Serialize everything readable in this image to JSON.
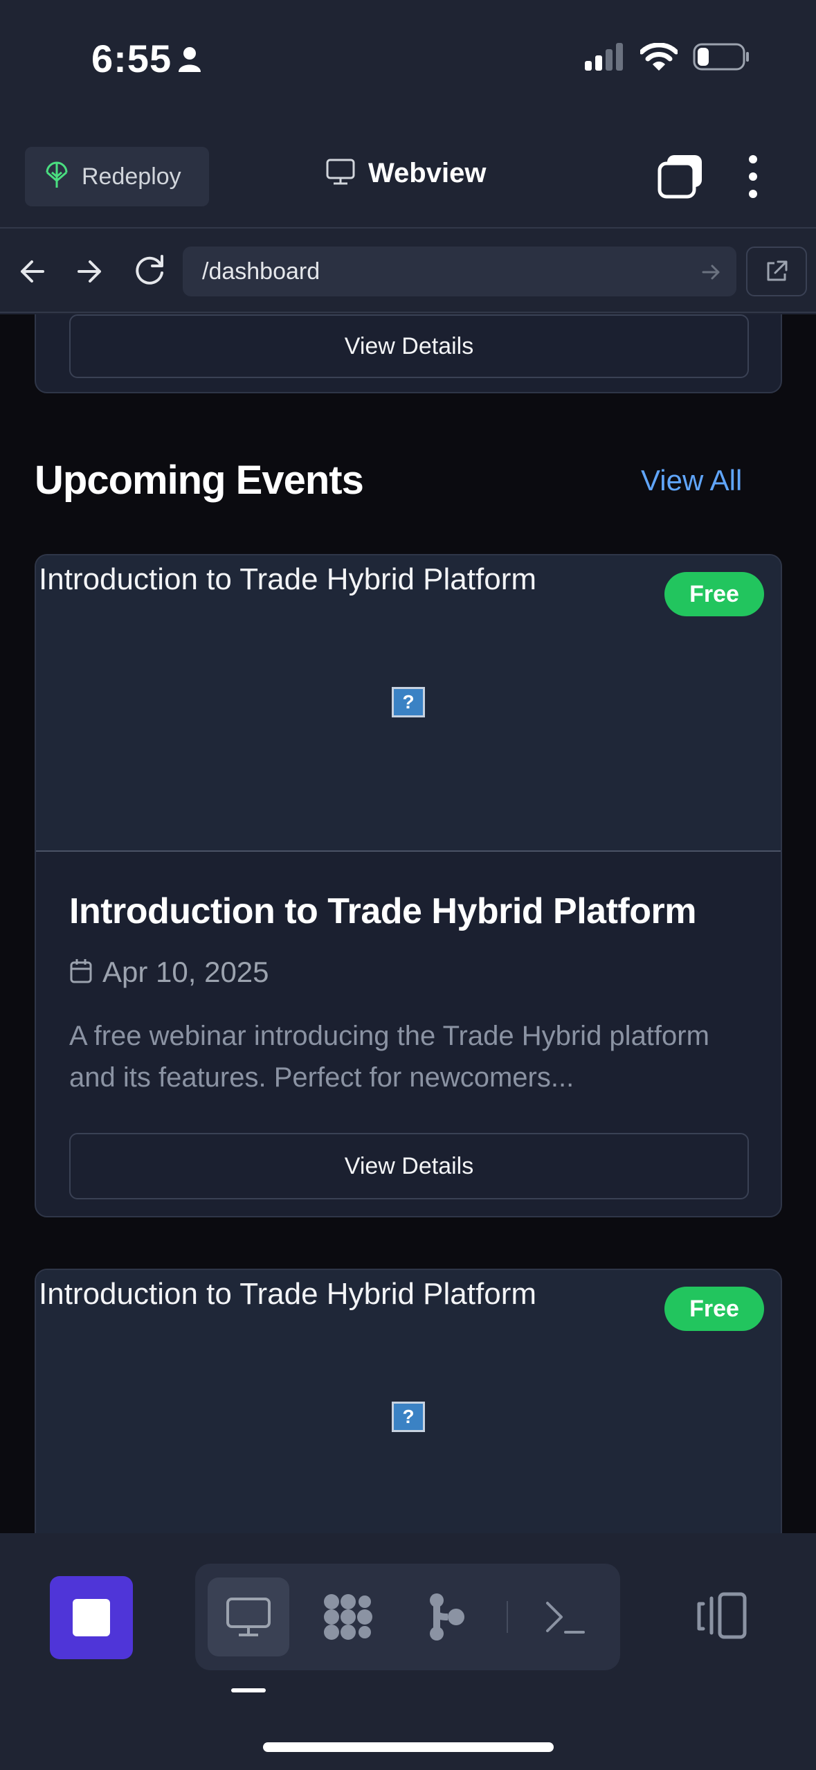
{
  "status_bar": {
    "time": "6:55"
  },
  "header": {
    "redeploy_label": "Redeploy",
    "title": "Webview"
  },
  "browser": {
    "url": "/dashboard"
  },
  "content": {
    "previous_card_button": "View Details",
    "section_title": "Upcoming Events",
    "view_all": "View All",
    "events": [
      {
        "image_alt": "Introduction to Trade Hybrid Platform",
        "badge": "Free",
        "title": "Introduction to Trade Hybrid Platform",
        "date": "Apr 10, 2025",
        "description": "A free webinar introducing the Trade Hybrid platform and its features. Perfect for newcomers...",
        "button": "View Details"
      },
      {
        "image_alt": "Introduction to Trade Hybrid Platform",
        "badge": "Free"
      }
    ]
  },
  "toolbar": {
    "items": [
      "stop-icon",
      "monitor-icon",
      "workflow-icon",
      "branch-icon",
      "terminal-icon",
      "panel-icon"
    ],
    "accent": "#4f35d8"
  },
  "colors": {
    "background": "#1f2433",
    "content_bg": "#0b0b10",
    "link": "#60a5fa",
    "badge": "#22c55e"
  }
}
